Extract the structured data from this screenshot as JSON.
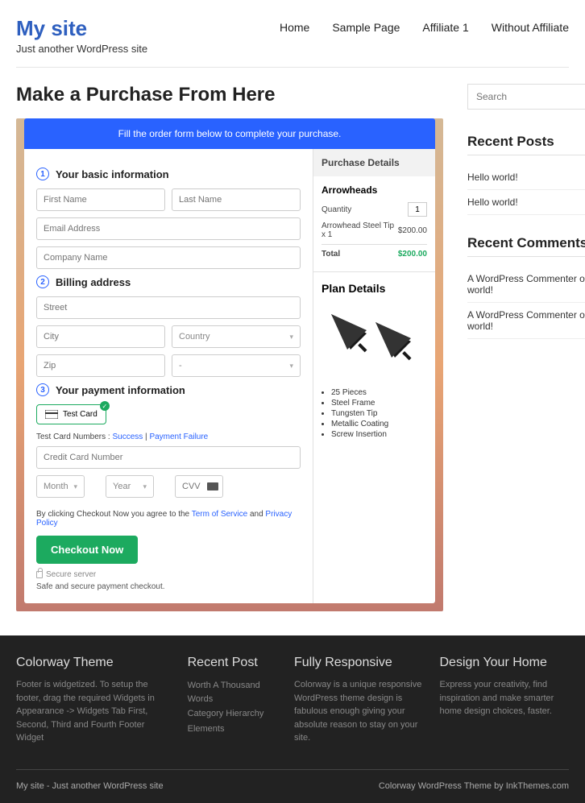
{
  "header": {
    "title": "My site",
    "tagline": "Just another WordPress site",
    "nav": [
      "Home",
      "Sample Page",
      "Affiliate 1",
      "Without Affiliate"
    ]
  },
  "page_title": "Make a Purchase From Here",
  "banner": "Fill the order form below to complete your purchase.",
  "form": {
    "s1_title": "Your basic information",
    "first_name_ph": "First Name",
    "last_name_ph": "Last Name",
    "email_ph": "Email Address",
    "company_ph": "Company Name",
    "s2_title": "Billing address",
    "street_ph": "Street",
    "city_ph": "City",
    "country_ph": "Country",
    "zip_ph": "Zip",
    "dash": "-",
    "s3_title": "Your payment information",
    "test_card": "Test Card",
    "tcn_label": "Test Card Numbers : ",
    "tcn_success": "Success",
    "tcn_sep": " | ",
    "tcn_failure": "Payment Failure",
    "cc_ph": "Credit Card Number",
    "month_ph": "Month",
    "year_ph": "Year",
    "cvv_ph": "CVV",
    "disc1": "By clicking Checkout Now you agree to the ",
    "disc_tos": "Term of Service",
    "disc_and": " and ",
    "disc_pp": "Privacy Policy",
    "checkout": "Checkout Now",
    "secure": "Secure server",
    "safe": "Safe and secure payment checkout."
  },
  "purchase": {
    "head": "Purchase Details",
    "title": "Arrowheads",
    "qty_label": "Quantity",
    "qty_val": "1",
    "item": "Arrowhead Steel Tip x 1",
    "item_price": "$200.00",
    "total_label": "Total",
    "total_val": "$200.00",
    "plan_head": "Plan Details",
    "features": [
      "25 Pieces",
      "Steel Frame",
      "Tungsten Tip",
      "Metallic Coating",
      "Screw Insertion"
    ]
  },
  "sidebar": {
    "search_ph": "Search",
    "recent_posts_h": "Recent Posts",
    "posts": [
      "Hello world!",
      "Hello world!"
    ],
    "recent_comments_h": "Recent Comments",
    "comments": [
      "A WordPress Commenter on Hello world!",
      "A WordPress Commenter on Hello world!"
    ]
  },
  "footer": {
    "col1_h": "Colorway Theme",
    "col1_txt": "Footer is widgetized. To setup the footer, drag the required Widgets in Appearance -> Widgets Tab First, Second, Third and Fourth Footer Widget",
    "col2_h": "Recent Post",
    "col2_links": [
      "Worth A Thousand Words",
      "Category Hierarchy",
      "Elements"
    ],
    "col3_h": "Fully Responsive",
    "col3_txt": "Colorway is a unique responsive WordPress theme design is fabulous enough giving your absolute reason to stay on your site.",
    "col4_h": "Design Your Home",
    "col4_txt": "Express your creativity, find inspiration and make smarter home design choices, faster.",
    "bar_left": "My site - Just another WordPress site",
    "bar_right": "Colorway WordPress Theme by InkThemes.com"
  }
}
